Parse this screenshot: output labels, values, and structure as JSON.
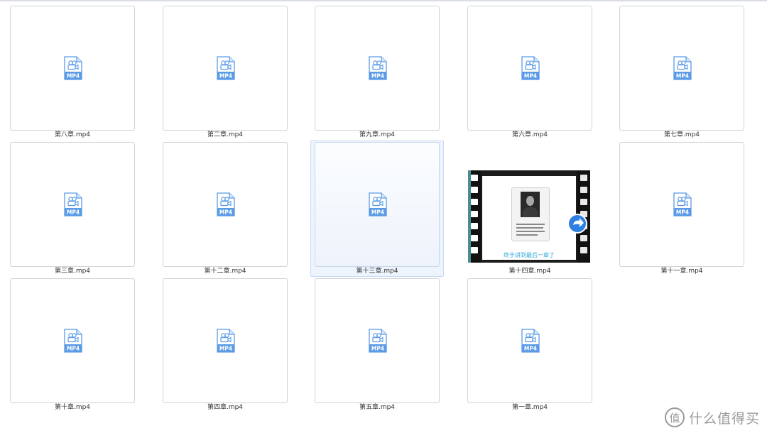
{
  "icon_label": "MP4",
  "icon_name": "video-file-icon",
  "accent_color": "#5b9be6",
  "files": [
    {
      "name": "第八章.mp4"
    },
    {
      "name": "第二章.mp4"
    },
    {
      "name": "第九章.mp4"
    },
    {
      "name": "第六章.mp4"
    },
    {
      "name": "第七章.mp4"
    },
    {
      "name": "第三章.mp4"
    },
    {
      "name": "第十二章.mp4"
    },
    {
      "name": "第十三章.mp4",
      "selected": true
    },
    {
      "name": "第十四章.mp4",
      "thumbnail": "video-frame",
      "thumbnail_caption": "终于讲到最后一章了"
    },
    {
      "name": "第十一章.mp4"
    },
    {
      "name": "第十章.mp4"
    },
    {
      "name": "第四章.mp4"
    },
    {
      "name": "第五章.mp4"
    },
    {
      "name": "第一章.mp4"
    }
  ],
  "watermark": {
    "text": "什么值得买",
    "icon": "值"
  }
}
